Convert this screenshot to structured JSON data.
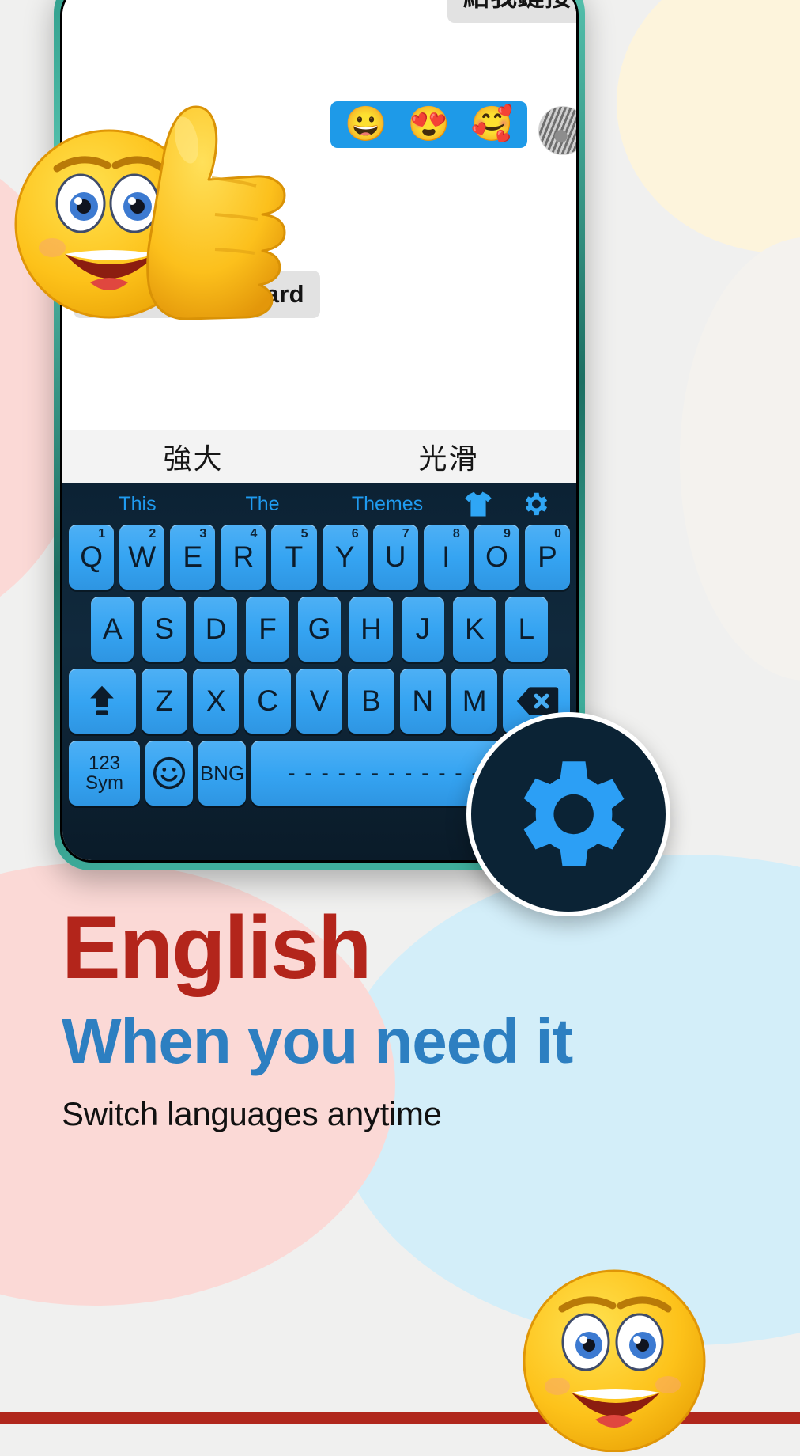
{
  "promo": {
    "headline_primary": "English",
    "headline_secondary": "When you need it",
    "subline": "Switch languages anytime",
    "color_primary": "#b3251b",
    "color_secondary": "#2d7fc1",
    "color_subline": "#111111"
  },
  "chat": {
    "messages": [
      {
        "id": "msg-cn-link",
        "side": "right",
        "type": "text",
        "text": "給我鏈接"
      },
      {
        "id": "msg-emoji",
        "side": "right",
        "type": "emoji",
        "emojis": [
          "😀",
          "😍",
          "🥰"
        ]
      },
      {
        "id": "msg-chinese-keyboard",
        "side": "left",
        "type": "text",
        "text": "Chinese keyboard"
      }
    ],
    "avatar_name": "avatar"
  },
  "keyboard": {
    "suggestions": [
      "強大",
      "光滑"
    ],
    "toolbar": {
      "words": [
        "This",
        "The",
        "Themes"
      ],
      "theme_icon": "tshirt-icon",
      "settings_icon": "gear-icon"
    },
    "rows": {
      "row1": [
        {
          "label": "Q",
          "sup": "1"
        },
        {
          "label": "W",
          "sup": "2"
        },
        {
          "label": "E",
          "sup": "3"
        },
        {
          "label": "R",
          "sup": "4"
        },
        {
          "label": "T",
          "sup": "5"
        },
        {
          "label": "Y",
          "sup": "6"
        },
        {
          "label": "U",
          "sup": "7"
        },
        {
          "label": "I",
          "sup": "8"
        },
        {
          "label": "O",
          "sup": "9"
        },
        {
          "label": "P",
          "sup": "0"
        }
      ],
      "row2": [
        {
          "label": "A"
        },
        {
          "label": "S"
        },
        {
          "label": "D"
        },
        {
          "label": "F"
        },
        {
          "label": "G"
        },
        {
          "label": "H"
        },
        {
          "label": "J"
        },
        {
          "label": "K"
        },
        {
          "label": "L"
        }
      ],
      "row3": [
        {
          "label": "",
          "icon": "shift-icon"
        },
        {
          "label": "Z"
        },
        {
          "label": "X"
        },
        {
          "label": "C"
        },
        {
          "label": "V"
        },
        {
          "label": "B"
        },
        {
          "label": "N"
        },
        {
          "label": "M"
        },
        {
          "label": "",
          "icon": "backspace-icon"
        }
      ],
      "row4": [
        {
          "label": "123\nSym",
          "line1": "123",
          "line2": "Sym"
        },
        {
          "label": "",
          "icon": "emoji-smiley-icon"
        },
        {
          "label": "BNG"
        },
        {
          "label": "- - - - - - - - - - - -"
        },
        {
          "label": ","
        }
      ]
    },
    "colors": {
      "key_fill": "#35a4f2",
      "keyboard_bg": "#10293c",
      "accent_text": "#1f9bf0"
    }
  },
  "badge": {
    "icon": "gear-icon",
    "name": "settings-badge"
  }
}
